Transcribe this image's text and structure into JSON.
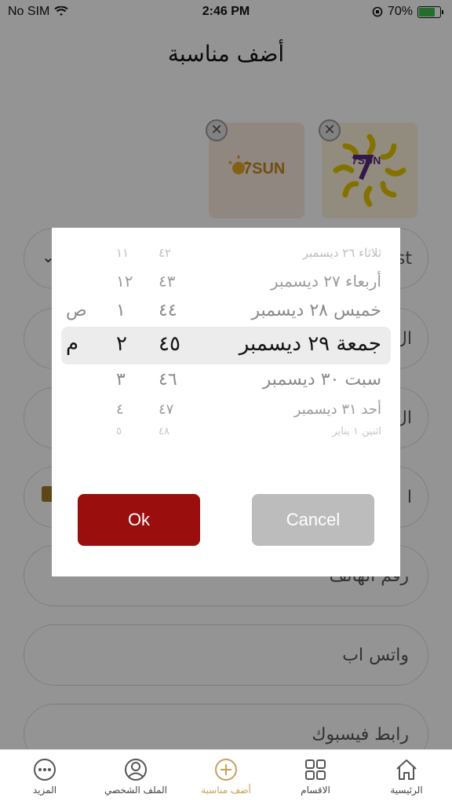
{
  "status_bar": {
    "carrier": "No SIM",
    "time": "2:46 PM",
    "battery": "70%"
  },
  "page": {
    "title": "أضف مناسبة",
    "logos": [
      {
        "text": "7SUN",
        "name": "logo-1"
      },
      {
        "text": "7SUN",
        "name": "logo-2"
      }
    ],
    "fields": {
      "visible_fragments": [
        "st",
        "ال",
        "ال",
        "ا"
      ],
      "phone_placeholder": "رقم الهاتف",
      "whatsapp_placeholder": "واتس اب",
      "facebook_placeholder": "رابط فيسبوك"
    }
  },
  "picker": {
    "rows": [
      {
        "date": "ثلاثاء ٢٦ ديسمبر",
        "minute": "٤٢",
        "hour": "١١",
        "ampm": ""
      },
      {
        "date": "أربعاء ٢٧ ديسمبر",
        "minute": "٤٣",
        "hour": "١٢",
        "ampm": ""
      },
      {
        "date": "خميس ٢٨ ديسمبر",
        "minute": "٤٤",
        "hour": "١",
        "ampm": "ص"
      },
      {
        "date": "جمعة ٢٩ ديسمبر",
        "minute": "٤٥",
        "hour": "٢",
        "ampm": "م"
      },
      {
        "date": "سبت ٣٠ ديسمبر",
        "minute": "٤٦",
        "hour": "٣",
        "ampm": ""
      },
      {
        "date": "أحد ٣١ ديسمبر",
        "minute": "٤٧",
        "hour": "٤",
        "ampm": ""
      },
      {
        "date": "اثنين ١ يناير",
        "minute": "٤٨",
        "hour": "٥",
        "ampm": ""
      }
    ],
    "selected_index": 3
  },
  "buttons": {
    "ok": "Ok",
    "cancel": "Cancel"
  },
  "tabbar": {
    "items": [
      {
        "label": "الرئيسية",
        "icon": "home-icon"
      },
      {
        "label": "الاقسام",
        "icon": "grid-icon"
      },
      {
        "label": "أضف مناسبة",
        "icon": "plus-circle-icon",
        "active": true
      },
      {
        "label": "الملف الشخصي",
        "icon": "user-icon"
      },
      {
        "label": "المزيد",
        "icon": "more-icon"
      }
    ]
  },
  "colors": {
    "accent": "#c9a05a",
    "ok": "#9a0e0e",
    "cancel": "#bcbcbc"
  }
}
